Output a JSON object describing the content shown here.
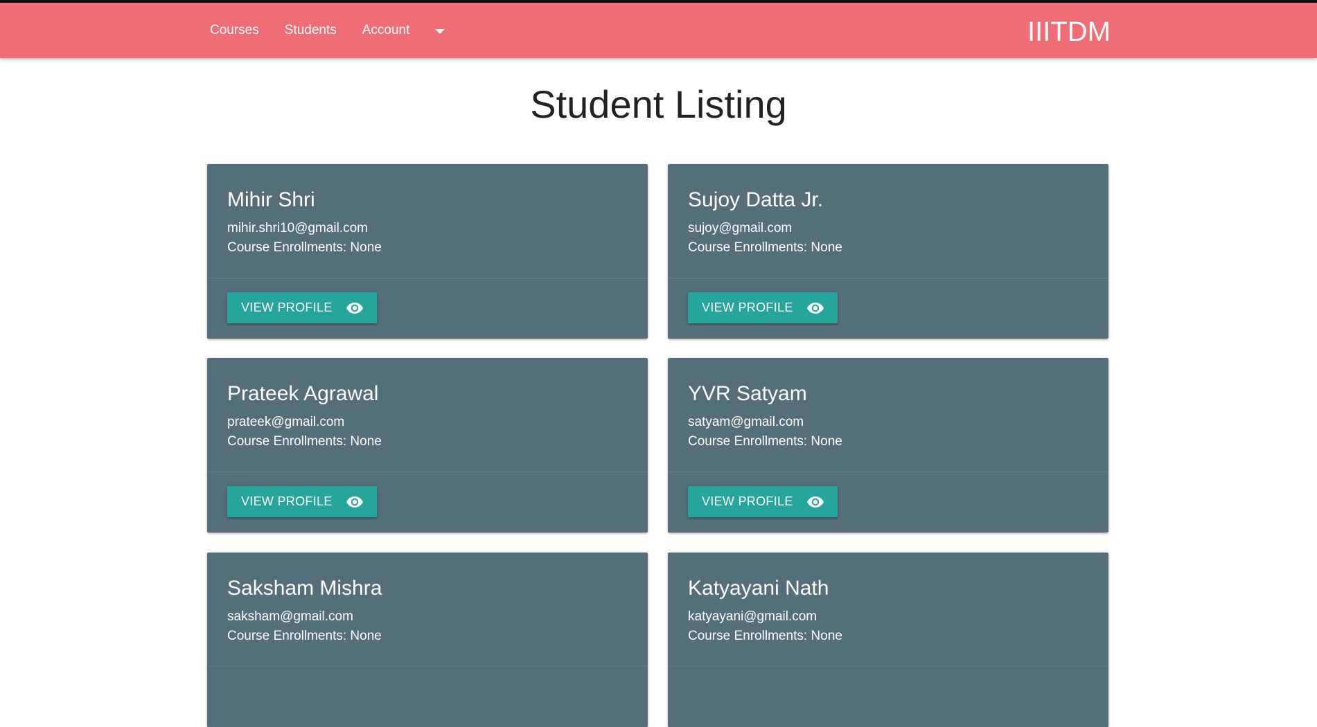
{
  "nav": {
    "links": [
      "Courses",
      "Students",
      "Account"
    ],
    "brand": "IIITDM"
  },
  "page": {
    "title": "Student Listing"
  },
  "students": [
    {
      "name": "Mihir Shri",
      "email": "mihir.shri10@gmail.com",
      "enrollments": "Course Enrollments: None"
    },
    {
      "name": "Sujoy Datta Jr.",
      "email": "sujoy@gmail.com",
      "enrollments": "Course Enrollments: None"
    },
    {
      "name": "Prateek Agrawal",
      "email": "prateek@gmail.com",
      "enrollments": "Course Enrollments: None"
    },
    {
      "name": "YVR Satyam",
      "email": "satyam@gmail.com",
      "enrollments": "Course Enrollments: None"
    },
    {
      "name": "Saksham Mishra",
      "email": "saksham@gmail.com",
      "enrollments": "Course Enrollments: None"
    },
    {
      "name": "Katyayani Nath",
      "email": "katyayani@gmail.com",
      "enrollments": "Course Enrollments: None"
    }
  ],
  "card_button_label": "VIEW PROFILE",
  "colors": {
    "navbar": "#ef6e75",
    "card": "#546e7a",
    "button": "#26a69a"
  },
  "icons": {
    "dropdown": "caret-down-icon",
    "view": "eye-icon"
  }
}
